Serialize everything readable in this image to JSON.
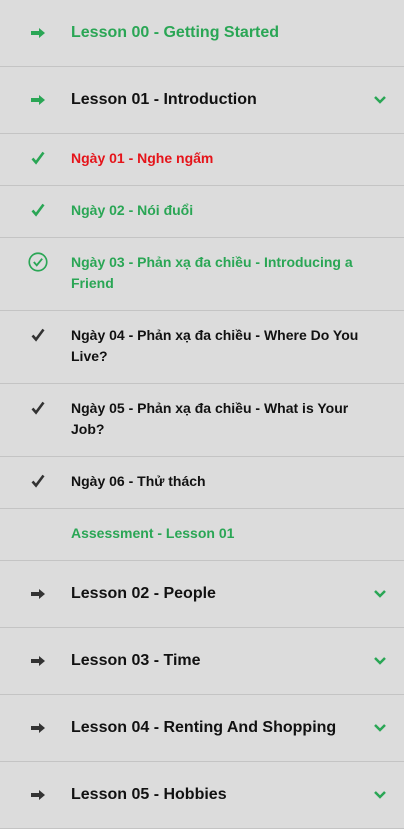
{
  "colors": {
    "green": "#2aa655",
    "red": "#e5141a",
    "dark": "#333333",
    "background": "#dcdcdc"
  },
  "items": [
    {
      "label": "Lesson 00 - Getting Started",
      "icon": "arrow-right-icon"
    },
    {
      "label": "Lesson 01 - Introduction",
      "icon": "arrow-right-icon",
      "expand_icon": "chevron-down-icon"
    },
    {
      "label": "Ngày 01 - Nghe ngấm",
      "icon": "check-icon"
    },
    {
      "label": "Ngày 02 - Nói đuổi",
      "icon": "check-icon"
    },
    {
      "label": "Ngày 03 - Phản xạ đa chiều - Introducing a Friend",
      "icon": "check-circle-icon"
    },
    {
      "label": "Ngày 04 - Phản xạ đa chiều - Where Do You Live?",
      "icon": "check-icon"
    },
    {
      "label": "Ngày 05 - Phản xạ đa chiều - What is Your Job?",
      "icon": "check-icon"
    },
    {
      "label": "Ngày 06 - Thử thách",
      "icon": "check-icon"
    },
    {
      "label": "Assessment - Lesson 01"
    },
    {
      "label": "Lesson 02 - People",
      "icon": "arrow-right-icon",
      "expand_icon": "chevron-down-icon"
    },
    {
      "label": "Lesson 03 - Time",
      "icon": "arrow-right-icon",
      "expand_icon": "chevron-down-icon"
    },
    {
      "label": "Lesson 04 - Renting And Shopping",
      "icon": "arrow-right-icon",
      "expand_icon": "chevron-down-icon"
    },
    {
      "label": "Lesson 05 - Hobbies",
      "icon": "arrow-right-icon",
      "expand_icon": "chevron-down-icon"
    }
  ]
}
